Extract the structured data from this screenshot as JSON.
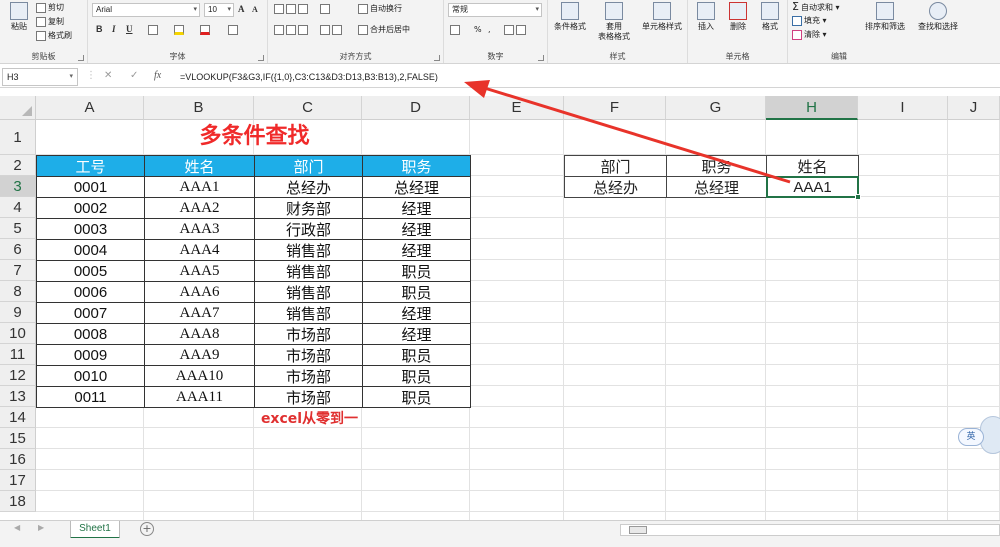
{
  "ribbon": {
    "clipboard": {
      "paste_label": "粘贴",
      "cut_label": "剪切",
      "copy_label": "复制",
      "format_painter_label": "格式刷",
      "group_label": "剪贴板"
    },
    "font": {
      "font_name": "Arial",
      "font_size": "10",
      "grow_label": "A",
      "shrink_label": "A",
      "bold": "B",
      "italic": "I",
      "underline": "U",
      "group_label": "字体"
    },
    "alignment": {
      "wrap_text_label": "自动换行",
      "merge_center_label": "合并后居中",
      "group_label": "对齐方式"
    },
    "number": {
      "format_value": "常规",
      "percent_label": "%",
      "comma_label": ",",
      "group_label": "数字"
    },
    "styles": {
      "conditional_label": "条件格式",
      "table_label": "套用\n表格格式",
      "cell_styles_label": "单元格样式",
      "group_label": "样式"
    },
    "cells": {
      "insert_label": "插入",
      "delete_label": "删除",
      "format_label": "格式",
      "group_label": "单元格"
    },
    "editing": {
      "autosum_label": "自动求和",
      "fill_label": "填充",
      "clear_label": "清除",
      "sort_filter_label": "排序和筛选",
      "find_select_label": "查找和选择",
      "group_label": "编辑"
    }
  },
  "formula_bar": {
    "name_box": "H3",
    "cancel_symbol": "✕",
    "enter_symbol": "✓",
    "fx_symbol": "fx",
    "formula": "=VLOOKUP(F3&G3,IF({1,0},C3:C13&D3:D13,B3:B13),2,FALSE)"
  },
  "columns": [
    "A",
    "B",
    "C",
    "D",
    "E",
    "F",
    "G",
    "H",
    "I",
    "J"
  ],
  "selected_column": "H",
  "rows": [
    "1",
    "2",
    "3",
    "4",
    "5",
    "6",
    "7",
    "8",
    "9",
    "10",
    "11",
    "12",
    "13",
    "14",
    "15",
    "16",
    "17",
    "18"
  ],
  "selected_row": "3",
  "sheet": {
    "title": "多条件查找",
    "table_headers": [
      "工号",
      "姓名",
      "部门",
      "职务"
    ],
    "table_rows": [
      [
        "0001",
        "AAA1",
        "总经办",
        "总经理"
      ],
      [
        "0002",
        "AAA2",
        "财务部",
        "经理"
      ],
      [
        "0003",
        "AAA3",
        "行政部",
        "经理"
      ],
      [
        "0004",
        "AAA4",
        "销售部",
        "经理"
      ],
      [
        "0005",
        "AAA5",
        "销售部",
        "职员"
      ],
      [
        "0006",
        "AAA6",
        "销售部",
        "职员"
      ],
      [
        "0007",
        "AAA7",
        "销售部",
        "经理"
      ],
      [
        "0008",
        "AAA8",
        "市场部",
        "经理"
      ],
      [
        "0009",
        "AAA9",
        "市场部",
        "职员"
      ],
      [
        "0010",
        "AAA10",
        "市场部",
        "职员"
      ],
      [
        "0011",
        "AAA11",
        "市场部",
        "职员"
      ]
    ],
    "lookup_headers": [
      "部门",
      "职务",
      "姓名"
    ],
    "lookup_values": [
      "总经办",
      "总经理",
      "AAA1"
    ],
    "note": "excel从零到一"
  },
  "ime": {
    "label": "英"
  },
  "tabs": {
    "sheet_name": "Sheet1",
    "add_symbol": "+"
  },
  "colors": {
    "header_fill": "#1eaee8",
    "title_red": "#f02a2a",
    "arrow_red": "#e8332a",
    "excel_green": "#217346"
  }
}
